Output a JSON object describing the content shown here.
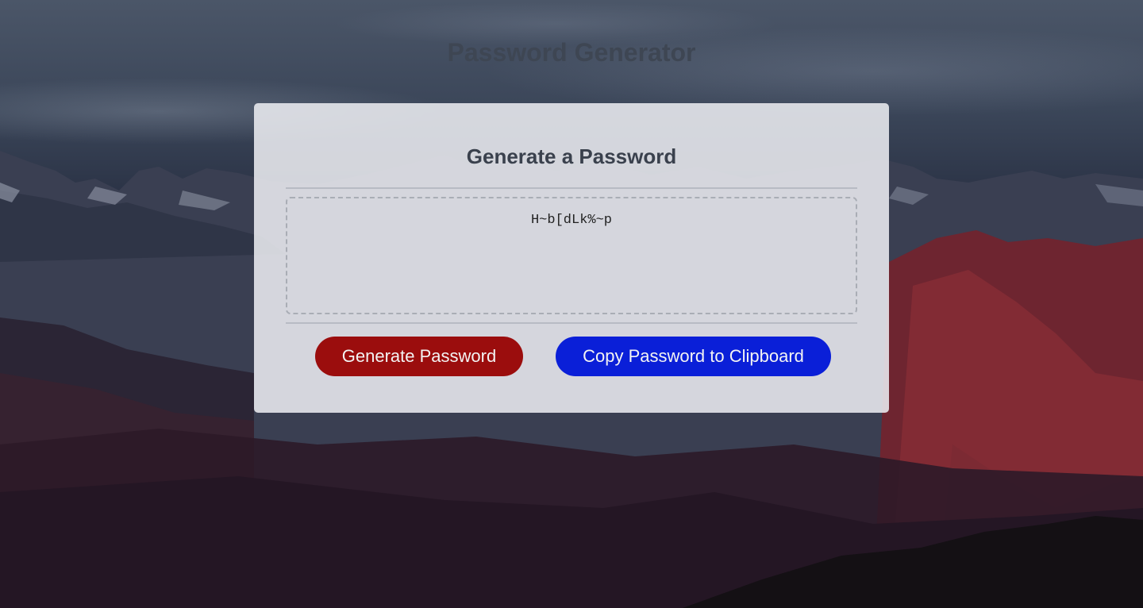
{
  "header": {
    "title": "Password Generator"
  },
  "card": {
    "title": "Generate a Password",
    "password_value": "H~b[dLk%~p"
  },
  "buttons": {
    "generate_label": "Generate Password",
    "copy_label": "Copy Password to Clipboard"
  },
  "colors": {
    "generate_button": "#9b0d0d",
    "copy_button": "#0a1fd8",
    "title_text": "#3e4653"
  }
}
